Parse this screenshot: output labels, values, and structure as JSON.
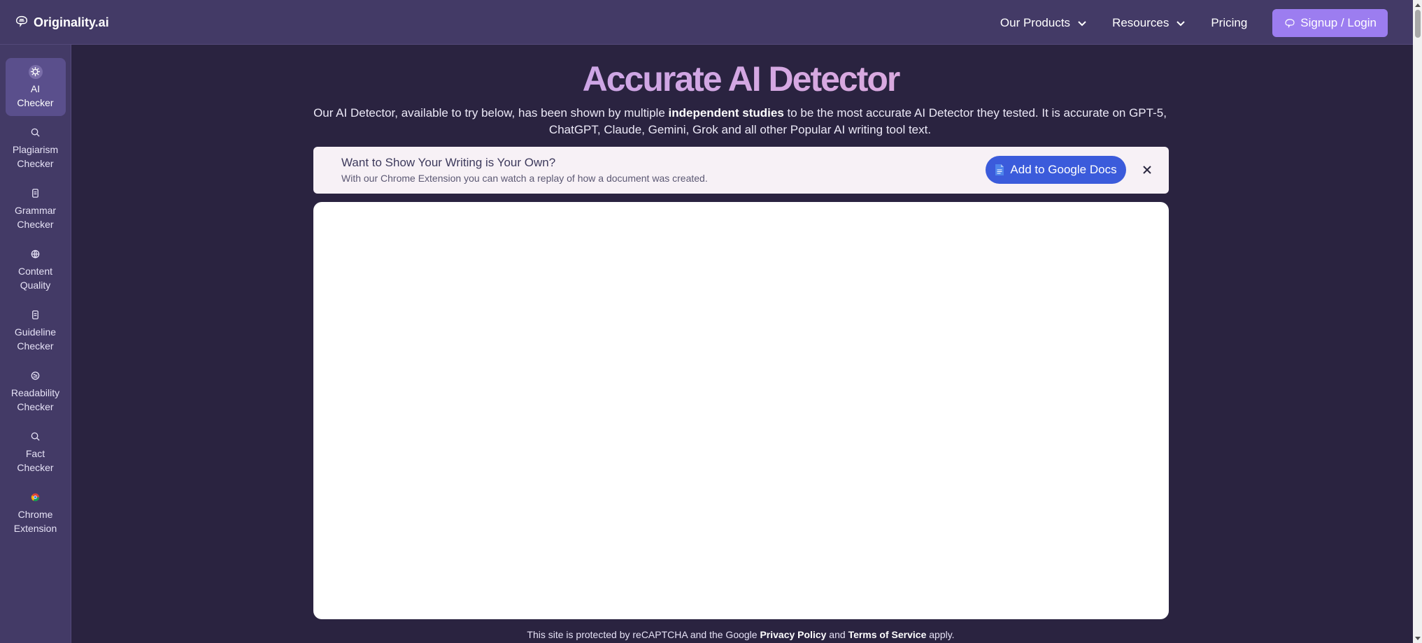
{
  "header": {
    "logo_text": "Originality.ai",
    "nav": [
      {
        "label": "Our Products",
        "has_dropdown": true
      },
      {
        "label": "Resources",
        "has_dropdown": true
      },
      {
        "label": "Pricing",
        "has_dropdown": false
      }
    ],
    "signup_label": "Signup / Login"
  },
  "sidebar": {
    "items": [
      {
        "line1": "AI",
        "line2": "Checker",
        "icon": "ai-chip-icon",
        "active": true
      },
      {
        "line1": "Plagiarism",
        "line2": "Checker",
        "icon": "magnifier-icon",
        "active": false
      },
      {
        "line1": "Grammar",
        "line2": "Checker",
        "icon": "document-icon",
        "active": false
      },
      {
        "line1": "Content",
        "line2": "Quality",
        "icon": "globe-icon",
        "active": false
      },
      {
        "line1": "Guideline",
        "line2": "Checker",
        "icon": "document-icon",
        "active": false
      },
      {
        "line1": "Readability",
        "line2": "Checker",
        "icon": "brain-icon",
        "active": false
      },
      {
        "line1": "Fact",
        "line2": "Checker",
        "icon": "magnifier-icon",
        "active": false
      },
      {
        "line1": "Chrome",
        "line2": "Extension",
        "icon": "chrome-icon",
        "active": false
      }
    ]
  },
  "main": {
    "title": "Accurate AI Detector",
    "intro_before": "Our AI Detector, available to try below, has been shown by multiple ",
    "intro_link": "independent studies",
    "intro_after": " to be the most accurate AI Detector they tested. It is accurate on GPT-5, ChatGPT, Claude, Gemini, Grok and all other Popular AI writing tool text.",
    "banner": {
      "title": "Want to Show Your Writing is Your Own?",
      "subtitle": "With our Chrome Extension you can watch a replay of how a document was created.",
      "button_label": "Add to Google Docs"
    },
    "footer": {
      "before": "This site is protected by reCAPTCHA and the Google ",
      "privacy": "Privacy Policy",
      "middle": " and ",
      "terms": "Terms of Service",
      "after": " apply."
    }
  },
  "colors": {
    "background": "#2a2340",
    "topbar": "#433a66",
    "signup_button": "#9c7df0",
    "gdocs_button": "#3b5bdb",
    "banner_bg": "#f7f1f6"
  }
}
